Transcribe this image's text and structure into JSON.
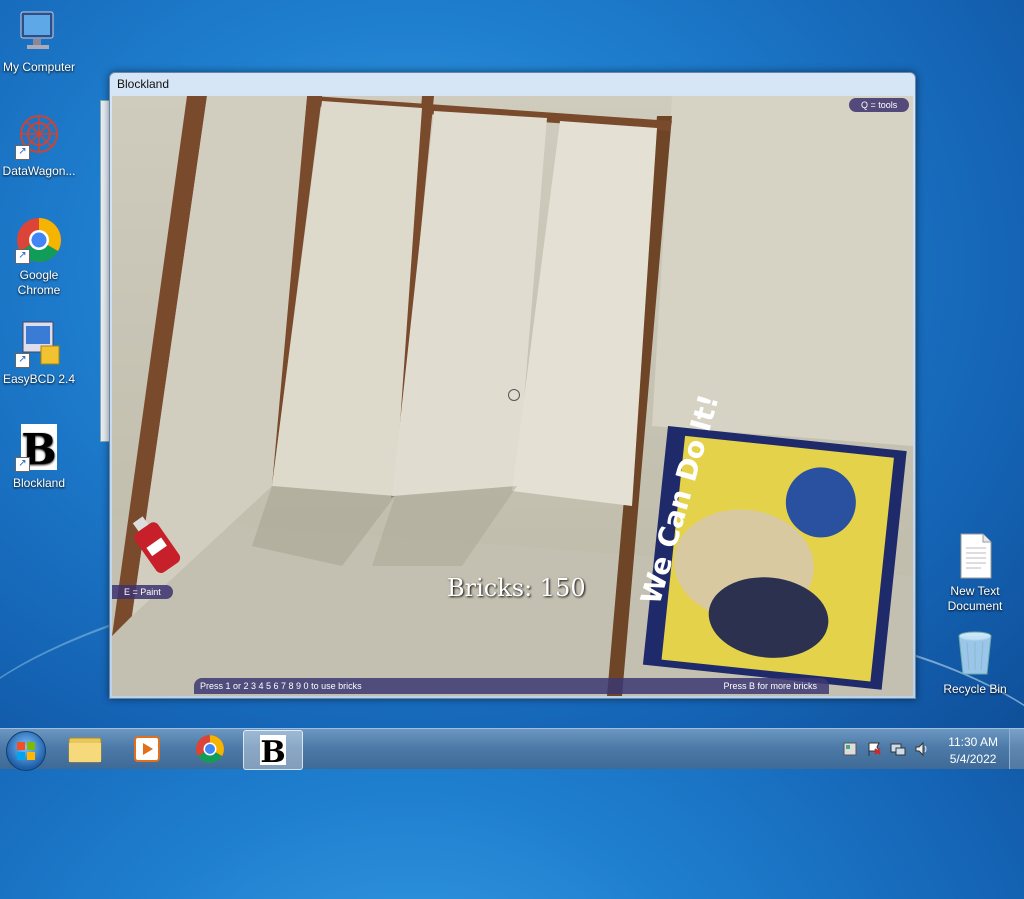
{
  "desktop": {
    "icons_left": [
      {
        "label": "My Computer",
        "icon": "computer-icon"
      },
      {
        "label": "DataWagon...",
        "icon": "datawagon-icon"
      },
      {
        "label": "Google Chrome",
        "icon": "chrome-icon"
      },
      {
        "label": "EasyBCD 2.4",
        "icon": "easybcd-icon"
      },
      {
        "label": "Blockland",
        "icon": "blockland-icon"
      }
    ],
    "icons_right": [
      {
        "label": "New Text Document",
        "icon": "text-document-icon"
      },
      {
        "label": "Recycle Bin",
        "icon": "recycle-bin-icon"
      }
    ]
  },
  "window": {
    "title": "Blockland",
    "hud": {
      "tools_hint": "Q = tools",
      "paint_hint": "E = Paint",
      "bricks_label": "Bricks: 150",
      "bottom_left": "Press 1 or  2 3 4 5 6 7 8 9 0 to use bricks",
      "bottom_right": "Press B for more bricks"
    },
    "poster_text": "We Can Do It!"
  },
  "taskbar": {
    "buttons": [
      "file-explorer-icon",
      "media-player-icon",
      "chrome-icon",
      "blockland-icon"
    ],
    "active": "blockland-icon",
    "clock_time": "11:30 AM",
    "clock_date": "5/4/2022",
    "tray_icons": [
      "action-center-icon",
      "flag-icon",
      "network-icon",
      "volume-icon"
    ]
  }
}
